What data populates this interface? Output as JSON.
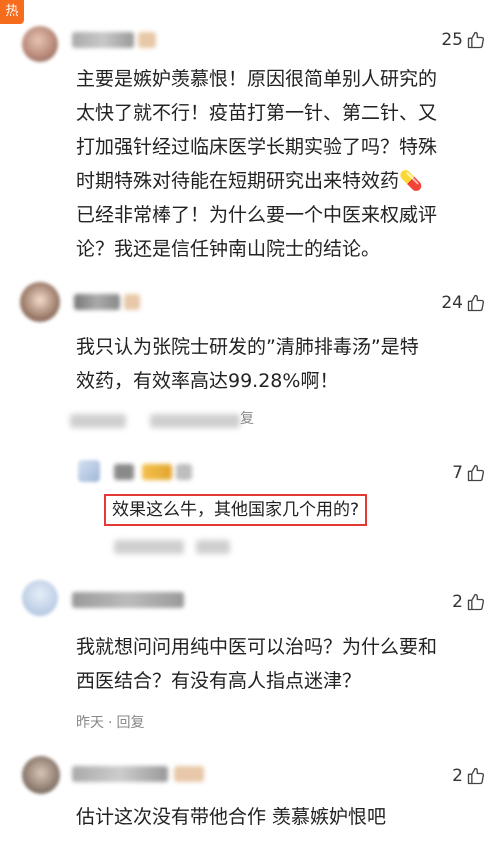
{
  "hot_tag": "热",
  "comments": [
    {
      "likes": "25",
      "text_lines": [
        "主要是嫉妒羡慕恨！原因很简单别人研究的",
        "太快了就不行！疫苗打第一针、第二针、又",
        "打加强针经过临床医学长期实验了吗？特殊",
        "时期特殊对待能在短期研究出来特效药💊",
        "已经非常棒了！为什么要一个中医来权威评",
        "论？我还是信任钟南山院士的结论。"
      ]
    },
    {
      "likes": "24",
      "text_lines": [
        "我只认为张院士研发的”清肺排毒汤”是特",
        "效药，有效率高达99.28%啊！"
      ],
      "meta_tail": "复"
    },
    {
      "likes": "7",
      "text": "效果这么牛，其他国家几个用的?"
    },
    {
      "likes": "2",
      "text_lines": [
        "我就想问问用纯中医可以治吗？为什么要和",
        "西医结合？有没有高人指点迷津？"
      ],
      "time": "昨天",
      "dot": "·",
      "reply": "回复"
    },
    {
      "likes": "2",
      "text_lines": [
        "估计这次没有带他合作 羡慕嫉妒恨吧"
      ]
    }
  ],
  "colors": {
    "hot_tag": "#f76b1c",
    "highlight_border": "#e53935"
  },
  "icons": {
    "like": "thumbs-up-icon"
  }
}
